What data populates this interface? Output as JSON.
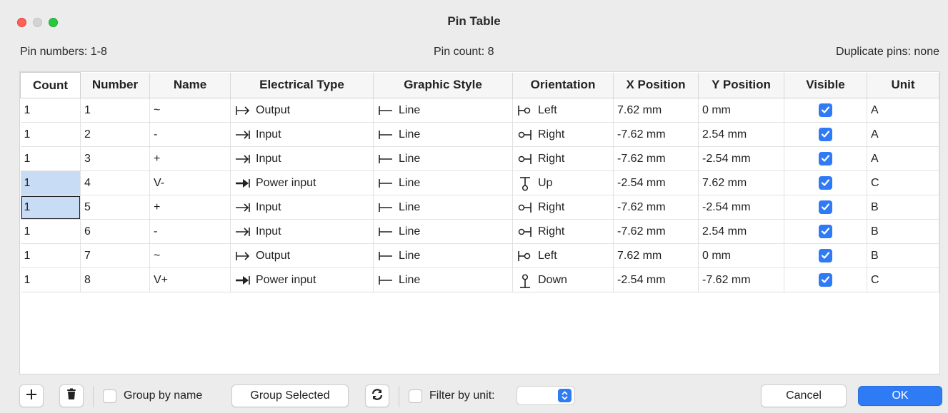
{
  "window": {
    "title": "Pin Table"
  },
  "info": {
    "pin_numbers": "Pin numbers: 1-8",
    "pin_count": "Pin count: 8",
    "duplicate_pins": "Duplicate pins: none"
  },
  "columns": [
    "Count",
    "Number",
    "Name",
    "Electrical Type",
    "Graphic Style",
    "Orientation",
    "X Position",
    "Y Position",
    "Visible",
    "Unit"
  ],
  "rows": [
    {
      "count": "1",
      "number": "1",
      "name": "~",
      "etype": "Output",
      "etype_icon": "output-icon",
      "style": "Line",
      "orientation": "Left",
      "orient_icon": "pin-left-icon",
      "x": "7.62 mm",
      "y": "0 mm",
      "visible": true,
      "unit": "A"
    },
    {
      "count": "1",
      "number": "2",
      "name": "-",
      "etype": "Input",
      "etype_icon": "input-icon",
      "style": "Line",
      "orientation": "Right",
      "orient_icon": "pin-right-icon",
      "x": "-7.62 mm",
      "y": "2.54 mm",
      "visible": true,
      "unit": "A"
    },
    {
      "count": "1",
      "number": "3",
      "name": "+",
      "etype": "Input",
      "etype_icon": "input-icon",
      "style": "Line",
      "orientation": "Right",
      "orient_icon": "pin-right-icon",
      "x": "-7.62 mm",
      "y": "-2.54 mm",
      "visible": true,
      "unit": "A"
    },
    {
      "count": "1",
      "number": "4",
      "name": "V-",
      "etype": "Power input",
      "etype_icon": "power-input-icon",
      "style": "Line",
      "orientation": "Up",
      "orient_icon": "pin-up-icon",
      "x": "-2.54 mm",
      "y": "7.62 mm",
      "visible": true,
      "unit": "C"
    },
    {
      "count": "1",
      "number": "5",
      "name": "+",
      "etype": "Input",
      "etype_icon": "input-icon",
      "style": "Line",
      "orientation": "Right",
      "orient_icon": "pin-right-icon",
      "x": "-7.62 mm",
      "y": "-2.54 mm",
      "visible": true,
      "unit": "B"
    },
    {
      "count": "1",
      "number": "6",
      "name": "-",
      "etype": "Input",
      "etype_icon": "input-icon",
      "style": "Line",
      "orientation": "Right",
      "orient_icon": "pin-right-icon",
      "x": "-7.62 mm",
      "y": "2.54 mm",
      "visible": true,
      "unit": "B"
    },
    {
      "count": "1",
      "number": "7",
      "name": "~",
      "etype": "Output",
      "etype_icon": "output-icon",
      "style": "Line",
      "orientation": "Left",
      "orient_icon": "pin-left-icon",
      "x": "7.62 mm",
      "y": "0 mm",
      "visible": true,
      "unit": "B"
    },
    {
      "count": "1",
      "number": "8",
      "name": "V+",
      "etype": "Power input",
      "etype_icon": "power-input-icon",
      "style": "Line",
      "orientation": "Down",
      "orient_icon": "pin-down-icon",
      "x": "-2.54 mm",
      "y": "-7.62 mm",
      "visible": true,
      "unit": "C"
    }
  ],
  "toolbar": {
    "add_icon": "plus-icon",
    "delete_icon": "trash-icon",
    "group_by_name_label": "Group by name",
    "group_by_name_checked": false,
    "group_selected_label": "Group Selected",
    "refresh_icon": "refresh-icon",
    "filter_by_unit_label": "Filter by unit:",
    "filter_by_unit_checked": false,
    "filter_unit_value": "",
    "cancel_label": "Cancel",
    "ok_label": "OK"
  },
  "colors": {
    "accent": "#2f7bf6",
    "selection": "#c9dcf6",
    "window_bg": "#ececec"
  }
}
